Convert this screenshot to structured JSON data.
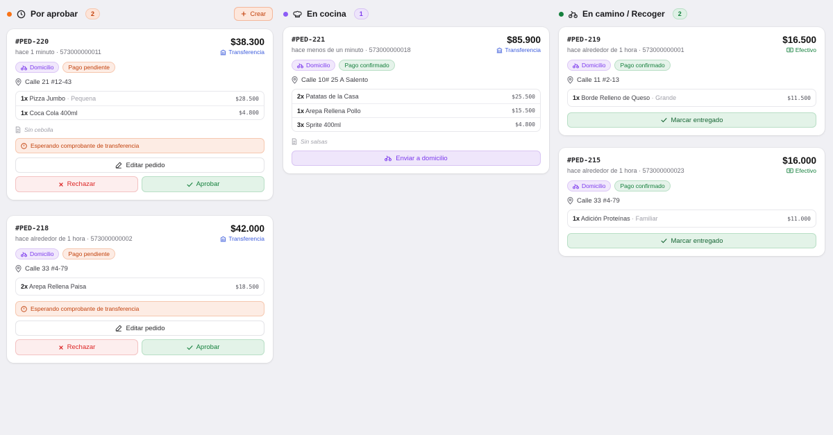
{
  "colors": {
    "pending_accent": "#f97316",
    "kitchen_accent": "#8b5cf6",
    "route_accent": "#15803d"
  },
  "columns": [
    {
      "title": "Por aprobar",
      "count": "2",
      "icon": "clock-icon",
      "create_label": "Crear",
      "cards": [
        {
          "id": "#PED-220",
          "price": "$38.300",
          "meta": "hace 1 minuto · 573000000011",
          "payment_method": "Transferencia",
          "tags": [
            "Domicilio",
            "Pago pendiente"
          ],
          "address": "Calle 21 #12-43",
          "items": [
            {
              "qty": "1x",
              "name": "Pizza Jumbo",
              "variant": "· Pequena",
              "price": "$28.500"
            },
            {
              "qty": "1x",
              "name": "Coca Cola 400ml",
              "variant": "",
              "price": "$4.800"
            }
          ],
          "note": "Sin cebolla",
          "alert": "Esperando comprobante de transferencia",
          "edit_label": "Editar pedido",
          "reject_label": "Rechazar",
          "approve_label": "Aprobar"
        },
        {
          "id": "#PED-218",
          "price": "$42.000",
          "meta": "hace alrededor de 1 hora · 573000000002",
          "payment_method": "Transferencia",
          "tags": [
            "Domicilio",
            "Pago pendiente"
          ],
          "address": "Calle 33 #4-79",
          "items": [
            {
              "qty": "2x",
              "name": "Arepa Rellena Paisa",
              "variant": "",
              "price": "$18.500"
            }
          ],
          "alert": "Esperando comprobante de transferencia",
          "edit_label": "Editar pedido",
          "reject_label": "Rechazar",
          "approve_label": "Aprobar"
        }
      ]
    },
    {
      "title": "En cocina",
      "count": "1",
      "icon": "chef-hat-icon",
      "cards": [
        {
          "id": "#PED-221",
          "price": "$85.900",
          "meta": "hace menos de un minuto · 573000000018",
          "payment_method": "Transferencia",
          "tags": [
            "Domicilio",
            "Pago confirmado"
          ],
          "address": "Calle 10# 25 A Salento",
          "items": [
            {
              "qty": "2x",
              "name": "Patatas de la Casa",
              "variant": "",
              "price": "$25.500"
            },
            {
              "qty": "1x",
              "name": "Arepa Rellena Pollo",
              "variant": "",
              "price": "$15.500"
            },
            {
              "qty": "3x",
              "name": "Sprite 400ml",
              "variant": "",
              "price": "$4.800"
            }
          ],
          "note": "Sin salsas",
          "action_label": "Enviar a domicilio"
        }
      ]
    },
    {
      "title": "En camino / Recoger",
      "count": "2",
      "icon": "bike-icon",
      "cards": [
        {
          "id": "#PED-219",
          "price": "$16.500",
          "meta": "hace alrededor de 1 hora · 573000000001",
          "payment_method": "Efectivo",
          "tags": [
            "Domicilio",
            "Pago confirmado"
          ],
          "address": "Calle 11 #2-13",
          "items": [
            {
              "qty": "1x",
              "name": "Borde Relleno de Queso",
              "variant": "· Grande",
              "price": "$11.500"
            }
          ],
          "action_label": "Marcar entregado"
        },
        {
          "id": "#PED-215",
          "price": "$16.000",
          "meta": "hace alrededor de 1 hora · 573000000023",
          "payment_method": "Efectivo",
          "tags": [
            "Domicilio",
            "Pago confirmado"
          ],
          "address": "Calle 33 #4-79",
          "items": [
            {
              "qty": "1x",
              "name": "Adición Proteínas",
              "variant": "· Familiar",
              "price": "$11.000"
            }
          ],
          "action_label": "Marcar entregado"
        }
      ]
    }
  ]
}
